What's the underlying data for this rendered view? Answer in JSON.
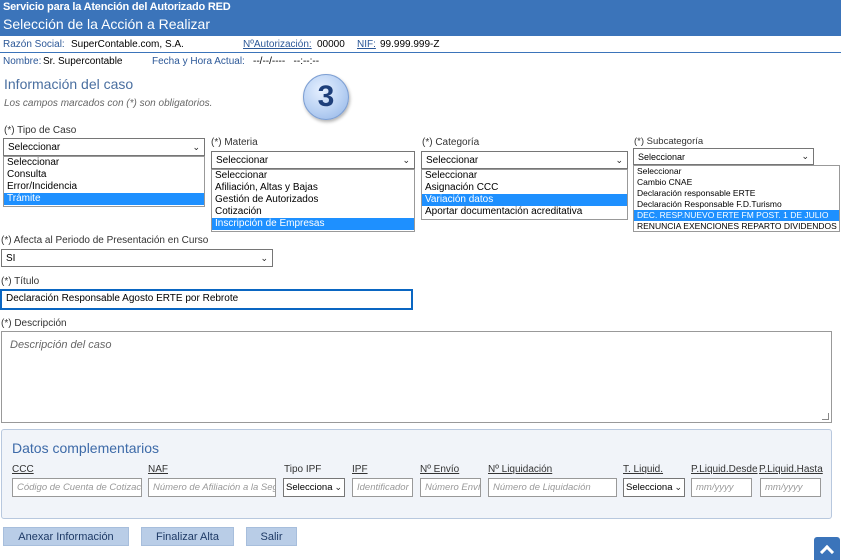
{
  "header": {
    "line1": "Servicio para la Atención del Autorizado RED",
    "line2": "Selección de la Acción a Realizar"
  },
  "info": {
    "razon_label": "Razón Social:",
    "razon_value": "SuperContable.com, S.A.",
    "nautoriz_label": "NºAutorización:",
    "nautoriz_value": "00000",
    "nif_label": "NIF:",
    "nif_value": "99.999.999-Z",
    "nombre_label": "Nombre:",
    "nombre_value": "Sr. Supercontable",
    "fecha_label": "Fecha y Hora Actual:",
    "fecha_value": "--/--/----   --:--:--"
  },
  "caso": {
    "title": "Información del caso",
    "hint": "Los campos marcados con (*) son obligatorios.",
    "step_badge": "3"
  },
  "tipo_caso": {
    "label": "(*) Tipo de Caso",
    "value": "Seleccionar",
    "options": [
      "Seleccionar",
      "Consulta",
      "Error/Incidencia",
      "Trámite"
    ],
    "selected_index": 3
  },
  "materia": {
    "label": "(*) Materia",
    "value": "Seleccionar",
    "options": [
      "Seleccionar",
      "Afiliación, Altas y Bajas",
      "Gestión de Autorizados",
      "Cotización",
      "Inscripción de Empresas"
    ],
    "selected_index": 4
  },
  "categoria": {
    "label": "(*) Categoría",
    "value": "Seleccionar",
    "options": [
      "Seleccionar",
      "Asignación CCC",
      "Variación datos",
      "Aportar documentación acreditativa"
    ],
    "selected_index": 2
  },
  "subcategoria": {
    "label": "(*) Subcategoría",
    "value": "Seleccionar",
    "options": [
      "Seleccionar",
      "Cambio CNAE",
      "Declaración responsable ERTE",
      "Declaración Responsable F.D.Turismo",
      "DEC. RESP.NUEVO ERTE FM POST. 1 DE JULIO",
      "RENUNCIA EXENCIONES REPARTO DIVIDENDOS"
    ],
    "selected_index": 4
  },
  "afecta": {
    "label": "(*) Afecta al Periodo de Presentación en Curso",
    "value": "SI"
  },
  "titulo": {
    "label": "(*) Título",
    "value": "Declaración Responsable Agosto ERTE por Rebrote"
  },
  "descripcion": {
    "label": "(*) Descripción",
    "placeholder": "Descripción del caso"
  },
  "complementarios": {
    "title": "Datos complementarios",
    "fields": [
      {
        "label": "CCC",
        "placeholder": "Código de Cuenta de Cotización",
        "kind": "input"
      },
      {
        "label": "NAF",
        "placeholder": "Número de Afiliación a la Seguridad Social",
        "kind": "input"
      },
      {
        "label": "Tipo IPF",
        "value": "Seleccionar",
        "kind": "select"
      },
      {
        "label": "IPF",
        "placeholder": "Identificador",
        "kind": "input"
      },
      {
        "label": "Nº Envío",
        "placeholder": "Número Envío",
        "kind": "input"
      },
      {
        "label": "Nº Liquidación",
        "placeholder": "Número de Liquidación",
        "kind": "input"
      },
      {
        "label": "T. Liquid.",
        "value": "Seleccionar",
        "kind": "select"
      },
      {
        "label": "P.Liquid.Desde",
        "placeholder": "mm/yyyy",
        "kind": "input"
      },
      {
        "label": "P.Liquid.Hasta",
        "placeholder": "mm/yyyy",
        "kind": "input"
      }
    ]
  },
  "buttons": {
    "anexar": "Anexar Información",
    "finalizar": "Finalizar Alta",
    "salir": "Salir"
  },
  "icons": {
    "scroll_top": "chevron-up-icon",
    "select_arrow": "chevron-down-icon"
  },
  "colors": {
    "header_bg": "#3b74ba",
    "selected_option": "#1e90ff",
    "button_bg": "#b9cde7"
  }
}
